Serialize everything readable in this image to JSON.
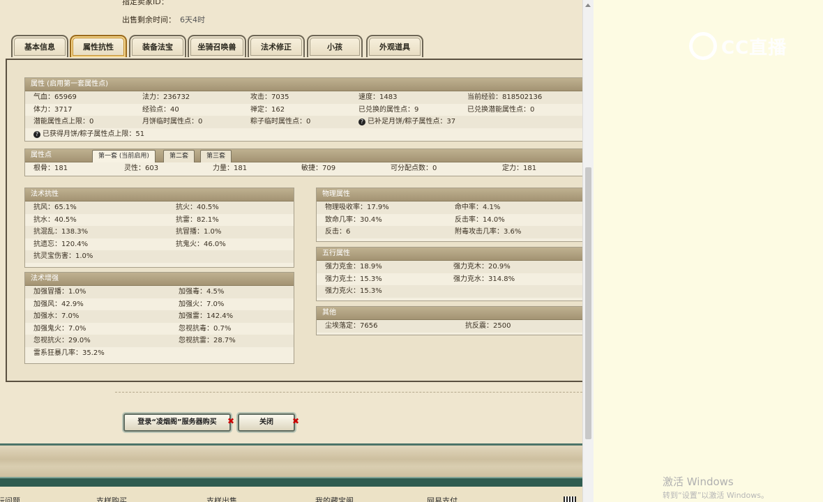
{
  "header": {
    "seller_id_label": "指定卖家ID：",
    "time_left_label": "出售剩余时间：",
    "time_left_value": "6天4时"
  },
  "tabs": [
    {
      "label": "基本信息"
    },
    {
      "label": "属性抗性",
      "active": true
    },
    {
      "label": "装备法宝"
    },
    {
      "label": "坐骑召唤兽"
    },
    {
      "label": "法术修正"
    },
    {
      "label": "小孩"
    },
    {
      "label": "外观道具"
    }
  ],
  "attributes": {
    "title": "属性 (启用第一套属性点)",
    "rows": [
      [
        "气血：65969",
        "法力：236732",
        "攻击：7035",
        "速度：1483",
        "当前经验：818502136"
      ],
      [
        "体力：3717",
        "经验点：40",
        "禅定：162",
        "已兑换的属性点：9",
        "已兑换潜能属性点：0"
      ],
      [
        "潜能属性点上限：0",
        "月饼临时属性点：0",
        "粽子临时属性点：0",
        "已补足月饼/粽子属性点：37"
      ],
      [
        "已获得月饼/粽子属性点上限：51"
      ]
    ]
  },
  "attr_points": {
    "title": "属性点",
    "subtabs": [
      "第一套 (当前启用)",
      "第二套",
      "第三套"
    ],
    "values": [
      "根骨：181",
      "灵性：603",
      "力量：181",
      "敏捷：709",
      "可分配点数：0",
      "定力：181"
    ]
  },
  "magic_resist": {
    "title": "法术抗性",
    "rows": [
      [
        "抗风：65.1%",
        "抗火：40.5%"
      ],
      [
        "抗水：40.5%",
        "抗雷：82.1%"
      ],
      [
        "抗混乱：138.3%",
        "抗冒播：1.0%"
      ],
      [
        "抗遗忘：120.4%",
        "抗鬼火：46.0%"
      ],
      [
        "抗灵宝伤害：1.0%",
        ""
      ]
    ]
  },
  "magic_boost": {
    "title": "法术增强",
    "rows": [
      [
        "加强冒播：1.0%",
        "加强毒：4.5%"
      ],
      [
        "加强风：42.9%",
        "加强火：7.0%"
      ],
      [
        "加强水：7.0%",
        "加强雷：142.4%"
      ],
      [
        "加强鬼火：7.0%",
        "忽视抗毒：0.7%"
      ],
      [
        "忽视抗火：29.0%",
        "忽视抗雷：28.7%"
      ],
      [
        "雷系狂暴几率：35.2%",
        ""
      ]
    ]
  },
  "physical": {
    "title": "物理属性",
    "rows": [
      [
        "物理吸收率：17.9%",
        "命中率：4.1%"
      ],
      [
        "致命几率：30.4%",
        "反击率：14.0%"
      ],
      [
        "反击：6",
        "附毒攻击几率：3.6%"
      ]
    ]
  },
  "five_elements": {
    "title": "五行属性",
    "rows": [
      [
        "强力克金：18.9%",
        "强力克木：20.9%"
      ],
      [
        "强力克土：15.3%",
        "强力克水：314.8%"
      ],
      [
        "强力克火：15.3%",
        ""
      ]
    ]
  },
  "others": {
    "title": "其他",
    "rows": [
      [
        "尘埃落定：7656",
        "抗反震：2500"
      ]
    ]
  },
  "buttons": {
    "buy": "登录“凌烟阁”服务器购买",
    "close": "关闭"
  },
  "footer_links": [
    "玩问题",
    "支样购买",
    "支样出售",
    "我的藏宝阁",
    "网易支付"
  ],
  "overlay": {
    "cc_logo_text": "CC直播",
    "windows_activate": "激活 Windows",
    "windows_activate_sub": "转到“设置”以激活 Windows。"
  }
}
